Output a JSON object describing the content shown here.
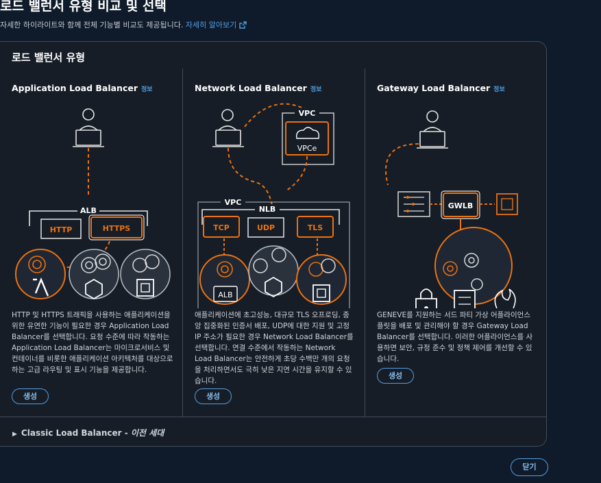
{
  "header": {
    "title": "로드 밸런서 유형 비교 및 선택",
    "subtitle": "자세한 하이라이트와 함께 전체 기능별 비교도 제공됩니다.",
    "learn_more": "자세히 알아보기"
  },
  "panel": {
    "title": "로드 밸런서 유형"
  },
  "columns": [
    {
      "title": "Application Load Balancer",
      "info": "정보",
      "diagram": {
        "alb": "ALB",
        "http": "HTTP",
        "https": "HTTPS"
      },
      "description": "HTTP 및 HTTPS 트래픽을 사용하는 애플리케이션을 위한 유연한 기능이 필요한 경우 Application Load Balancer를 선택합니다. 요청 수준에 따라 작동하는 Application Load Balancer는 마이크로서비스 및 컨테이너를 비롯한 애플리케이션 아키텍처를 대상으로 하는 고급 라우팅 및 표시 기능을 제공합니다.",
      "create": "생성"
    },
    {
      "title": "Network Load Balancer",
      "info": "정보",
      "diagram": {
        "vpc_top": "VPC",
        "vpce": "VPCe",
        "vpc": "VPC",
        "nlb": "NLB",
        "tcp": "TCP",
        "udp": "UDP",
        "tls": "TLS",
        "alb": "ALB"
      },
      "description": "애플리케이션에 초고성능, 대규모 TLS 오프로딩, 중앙 집중화된 인증서 배포, UDP에 대한 지원 및 고정 IP 주소가 필요한 경우 Network Load Balancer를 선택합니다. 연결 수준에서 작동하는 Network Load Balancer는 안전하게 초당 수백만 개의 요청을 처리하면서도 극히 낮은 지연 시간을 유지할 수 있습니다.",
      "create": "생성"
    },
    {
      "title": "Gateway Load Balancer",
      "info": "정보",
      "diagram": {
        "gwlb": "GWLB"
      },
      "description": "GENEVE를 지원하는 서드 파티 가상 어플라이언스 플릿을 배포 및 관리해야 할 경우 Gateway Load Balancer를 선택합니다. 이러한 어플라이언스를 사용하면 보안, 규정 준수 및 정책 제어를 개선할 수 있습니다.",
      "create": "생성"
    }
  ],
  "classic": {
    "label": "Classic Load Balancer - ",
    "suffix": "이전 세대"
  },
  "footer": {
    "close": "닫기"
  },
  "colors": {
    "accent": "#ec7211",
    "link": "#539fe5",
    "background": "#0f1b2a",
    "panel": "#161d26"
  }
}
